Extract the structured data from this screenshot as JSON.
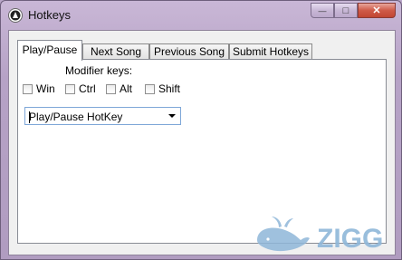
{
  "window": {
    "title": "Hotkeys",
    "controls": {
      "minimize": "—",
      "maximize": "□",
      "close": "✕"
    }
  },
  "tabs": [
    {
      "label": "Play/Pause",
      "active": true
    },
    {
      "label": "Next Song",
      "active": false
    },
    {
      "label": "Previous Song",
      "active": false
    },
    {
      "label": "Submit Hotkeys",
      "active": false
    }
  ],
  "panel": {
    "modifier_label": "Modifier keys:",
    "modifiers": [
      {
        "label": "Win",
        "checked": false
      },
      {
        "label": "Ctrl",
        "checked": false
      },
      {
        "label": "Alt",
        "checked": false
      },
      {
        "label": "Shift",
        "checked": false
      }
    ],
    "hotkey_combo": {
      "value": "Play/Pause HotKey"
    }
  },
  "watermark": {
    "text": "ZIGG",
    "color": "#8fb7d9"
  }
}
